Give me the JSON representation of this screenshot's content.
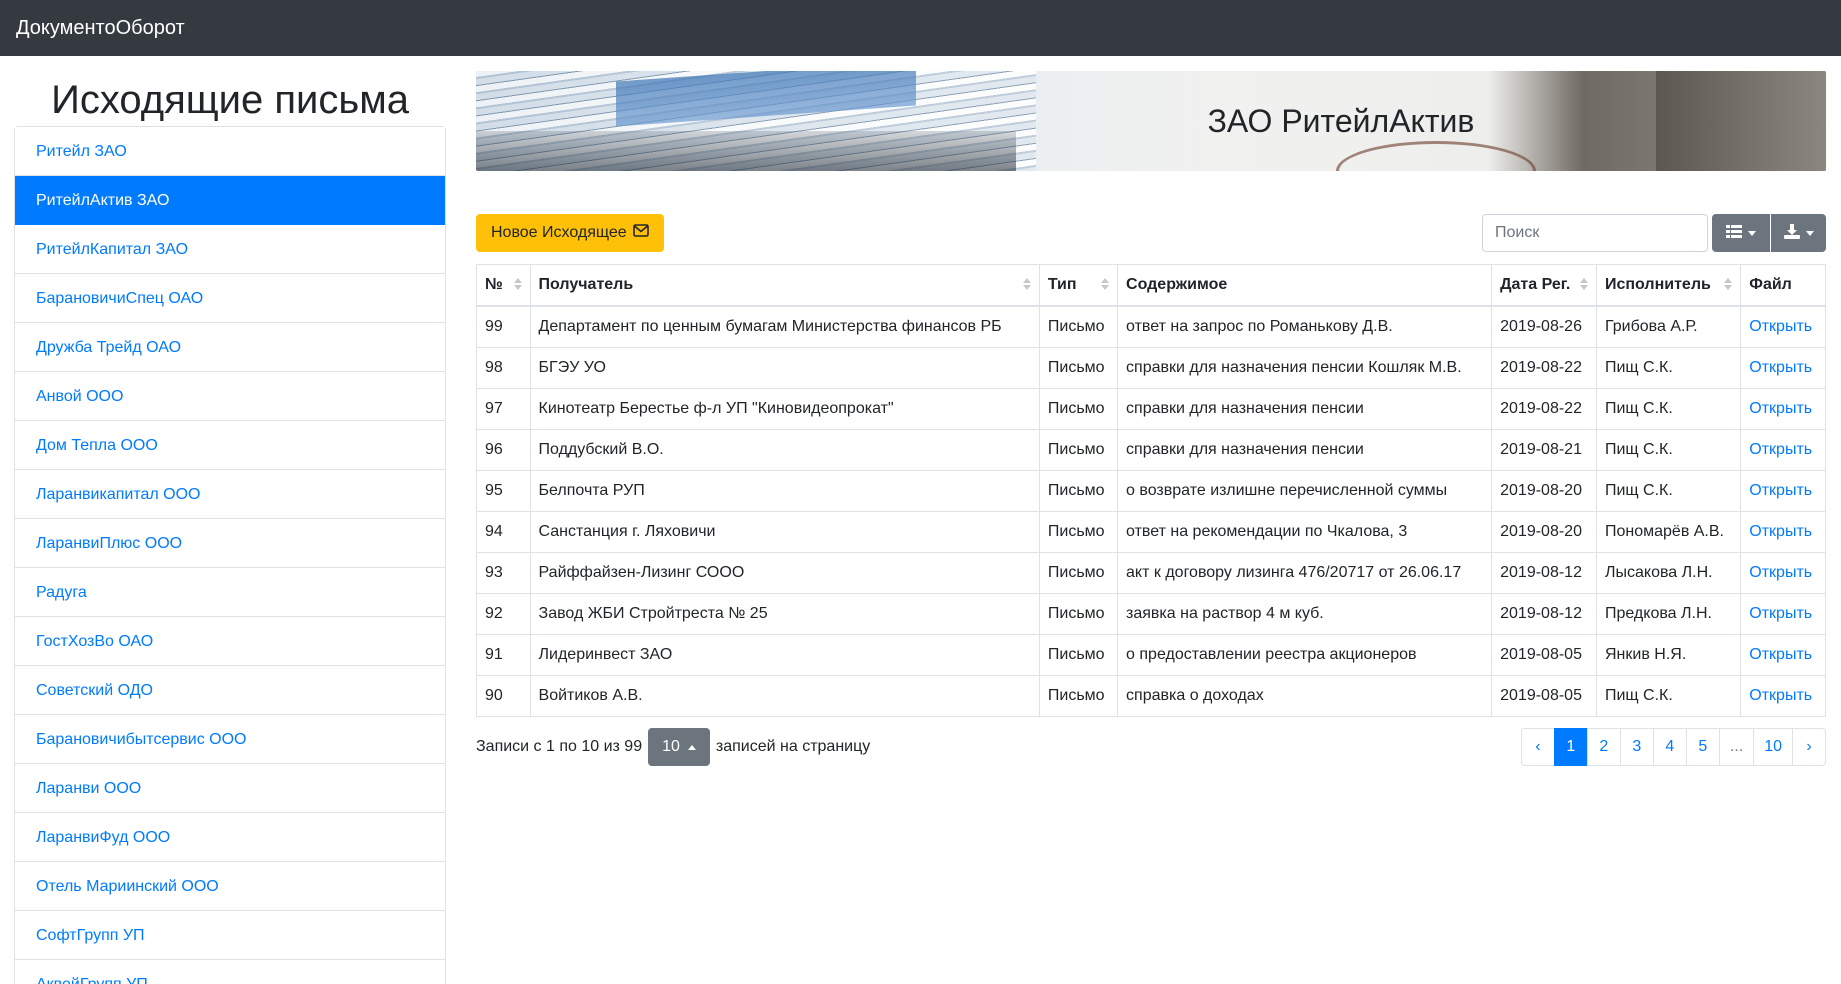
{
  "navbar": {
    "brand": "ДокументоОборот"
  },
  "sidebar": {
    "title": "Исходящие письма",
    "items": [
      {
        "label": "Ритейл ЗАО",
        "active": false
      },
      {
        "label": "РитейлАктив ЗАО",
        "active": true
      },
      {
        "label": "РитейлКапитал ЗАО",
        "active": false
      },
      {
        "label": "БарановичиСпец ОАО",
        "active": false
      },
      {
        "label": "Дружба Трейд ОАО",
        "active": false
      },
      {
        "label": "Анвой ООО",
        "active": false
      },
      {
        "label": "Дом Тепла ООО",
        "active": false
      },
      {
        "label": "Ларанвикапитал ООО",
        "active": false
      },
      {
        "label": "ЛаранвиПлюс ООО",
        "active": false
      },
      {
        "label": "Радуга",
        "active": false
      },
      {
        "label": "ГостХозВо ОАО",
        "active": false
      },
      {
        "label": "Советский ОДО",
        "active": false
      },
      {
        "label": "Барановичибытсервис ООО",
        "active": false
      },
      {
        "label": "Ларанви ООО",
        "active": false
      },
      {
        "label": "ЛаранвиФуд ООО",
        "active": false
      },
      {
        "label": "Отель Мариинский ООО",
        "active": false
      },
      {
        "label": "СофтГрупп УП",
        "active": false
      },
      {
        "label": "АквейГрупп УП",
        "active": false
      }
    ]
  },
  "banner": {
    "title": "ЗАО РитейлАктив"
  },
  "toolbar": {
    "new_label": "Новое Исходящее",
    "search_placeholder": "Поиск",
    "columns_icon": "list-icon",
    "export_icon": "download-icon"
  },
  "table": {
    "headers": [
      "№",
      "Получатель",
      "Тип",
      "Содержимое",
      "Дата Рег.",
      "Исполнитель",
      "Файл"
    ],
    "rows": [
      [
        "99",
        "Департамент по ценным бумагам Министерства финансов РБ",
        "Письмо",
        "ответ на запрос по Романькову Д.В.",
        "2019-08-26",
        "Грибова А.Р.",
        "Открыть"
      ],
      [
        "98",
        "БГЭУ УО",
        "Письмо",
        "справки для назначения пенсии Кошляк М.В.",
        "2019-08-22",
        "Пищ С.К.",
        "Открыть"
      ],
      [
        "97",
        "Кинотеатр Берестье ф-л УП \"Киновидеопрокат\"",
        "Письмо",
        "справки для назначения пенсии",
        "2019-08-22",
        "Пищ С.К.",
        "Открыть"
      ],
      [
        "96",
        "Поддубский В.О.",
        "Письмо",
        "справки для назначения пенсии",
        "2019-08-21",
        "Пищ С.К.",
        "Открыть"
      ],
      [
        "95",
        "Белпочта РУП",
        "Письмо",
        "о возврате излишне перечисленной суммы",
        "2019-08-20",
        "Пищ С.К.",
        "Открыть"
      ],
      [
        "94",
        "Санстанция г. Ляховичи",
        "Письмо",
        "ответ на рекомендации по Чкалова, 3",
        "2019-08-20",
        "Пономарёв А.В.",
        "Открыть"
      ],
      [
        "93",
        "Райффайзен-Лизинг СООО",
        "Письмо",
        "акт к договору лизинга 476/20717 от 26.06.17",
        "2019-08-12",
        "Лысакова Л.Н.",
        "Открыть"
      ],
      [
        "92",
        "Завод ЖБИ Стройтреста № 25",
        "Письмо",
        "заявка на раствор 4 м куб.",
        "2019-08-12",
        "Предкова Л.Н.",
        "Открыть"
      ],
      [
        "91",
        "Лидеринвест ЗАО",
        "Письмо",
        "о предоставлении реестра акционеров",
        "2019-08-05",
        "Янкив Н.Я.",
        "Открыть"
      ],
      [
        "90",
        "Войтиков А.В.",
        "Письмо",
        "справка о доходах",
        "2019-08-05",
        "Пищ С.К.",
        "Открыть"
      ]
    ]
  },
  "footer": {
    "records_text": "Записи с 1 по 10 из 99",
    "page_size": "10",
    "per_page_text": "записей на страницу"
  },
  "pagination": {
    "prev": "‹",
    "pages": [
      "1",
      "2",
      "3",
      "4",
      "5",
      "...",
      "10"
    ],
    "active": "1",
    "next": "›"
  },
  "colors": {
    "navbar": "#343a40",
    "primary": "#007bff",
    "warning": "#ffc107",
    "secondary": "#6c757d"
  }
}
